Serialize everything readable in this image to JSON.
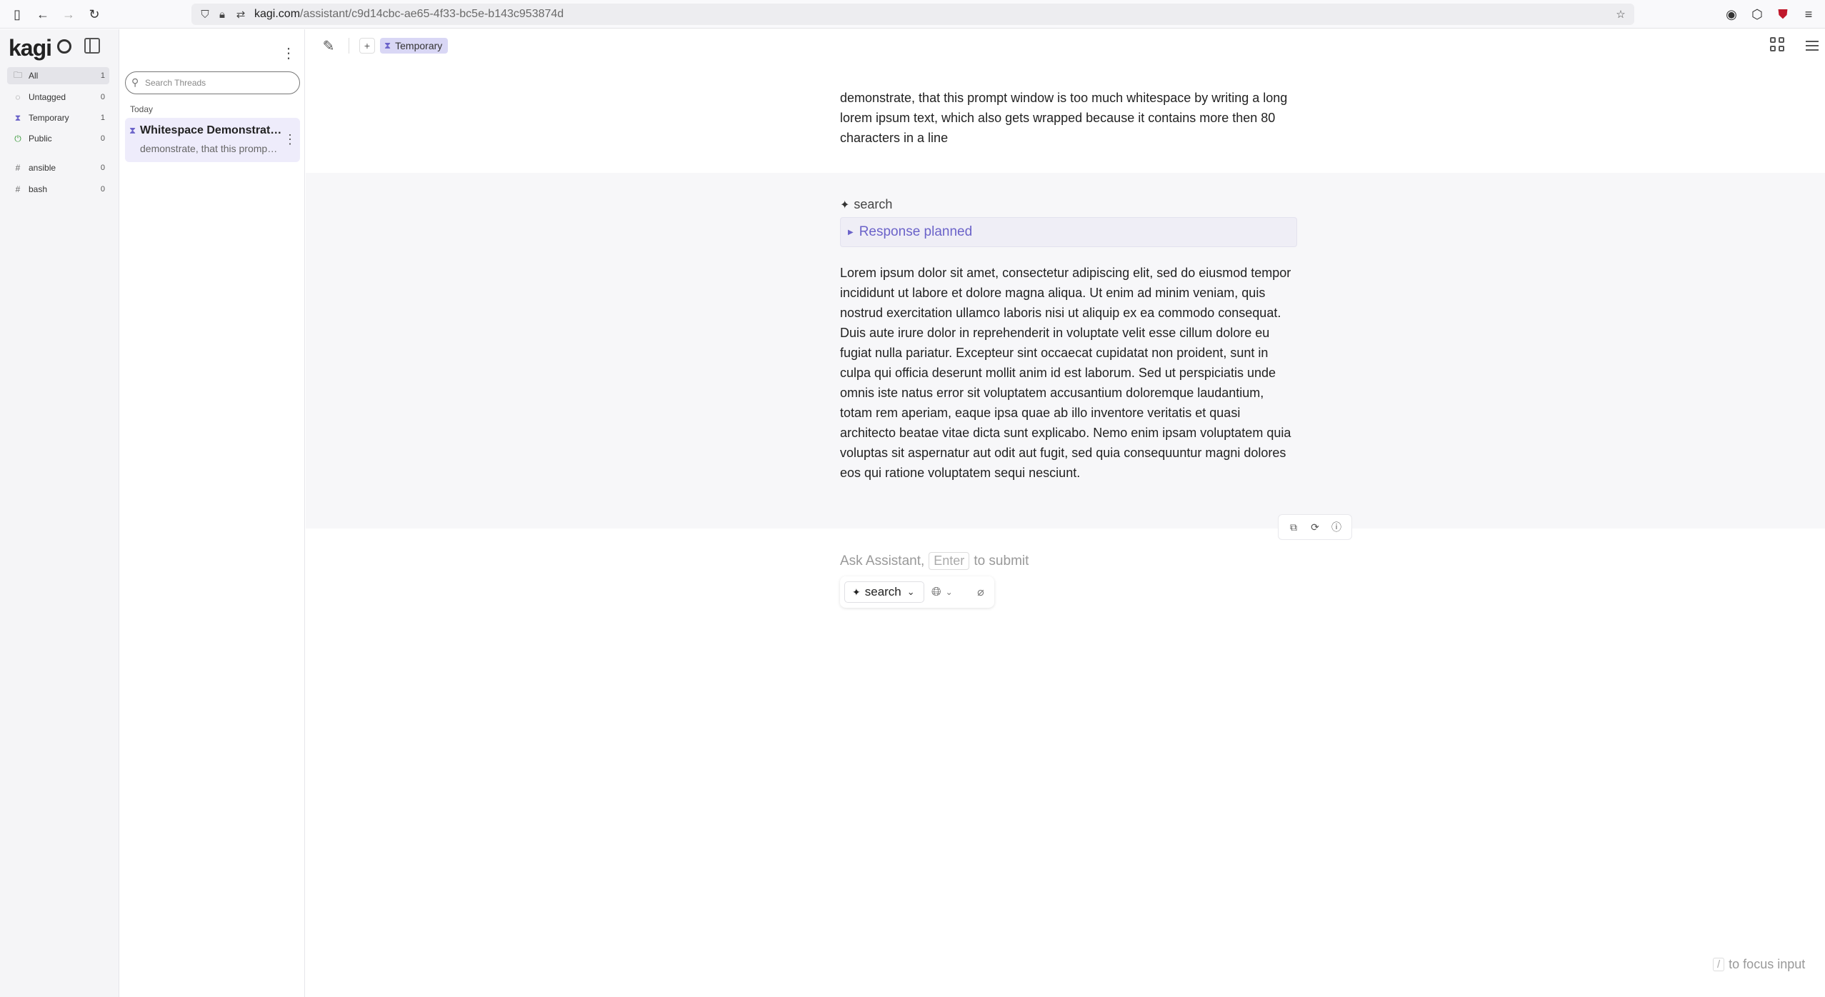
{
  "browser": {
    "url_host": "kagi.com",
    "url_path": "/assistant/c9d14cbc-ae65-4f33-bc5e-b143c953874d"
  },
  "sidebar": {
    "logo": "kagi",
    "items": [
      {
        "label": "All",
        "count": "1",
        "icon": "folder-icon"
      },
      {
        "label": "Untagged",
        "count": "0",
        "icon": "circle-dashed-icon"
      },
      {
        "label": "Temporary",
        "count": "1",
        "icon": "hourglass-icon"
      },
      {
        "label": "Public",
        "count": "0",
        "icon": "power-icon"
      },
      {
        "label": "ansible",
        "count": "0",
        "icon": "hash-icon"
      },
      {
        "label": "bash",
        "count": "0",
        "icon": "hash-icon"
      }
    ]
  },
  "threads": {
    "search_placeholder": "Search Threads",
    "group_label": "Today",
    "items": [
      {
        "title": "Whitespace Demonstration",
        "snippet": "demonstrate, that this prompt window is too much whitespace"
      }
    ]
  },
  "header": {
    "tag_add": "+",
    "tag_label": "Temporary"
  },
  "conversation": {
    "user_message": "demonstrate, that this prompt window is too much whitespace by writing a long lorem ipsum text, which also gets wrapped because it contains more then 80 characters in a line",
    "model_name": "search",
    "planned_label": "Response planned",
    "answer": "Lorem ipsum dolor sit amet, consectetur adipiscing elit, sed do eiusmod tempor incididunt ut labore et dolore magna aliqua. Ut enim ad minim veniam, quis nostrud exercitation ullamco laboris nisi ut aliquip ex ea commodo consequat. Duis aute irure dolor in reprehenderit in voluptate velit esse cillum dolore eu fugiat nulla pariatur. Excepteur sint occaecat cupidatat non proident, sunt in culpa qui officia deserunt mollit anim id est laborum. Sed ut perspiciatis unde omnis iste natus error sit voluptatem accusantium doloremque laudantium, totam rem aperiam, eaque ipsa quae ab illo inventore veritatis et quasi architecto beatae vitae dicta sunt explicabo. Nemo enim ipsam voluptatem quia voluptas sit aspernatur aut odit aut fugit, sed quia consequuntur magni dolores eos qui ratione voluptatem sequi nesciunt."
  },
  "input": {
    "ask_prefix": "Ask Assistant,",
    "ask_key": "Enter",
    "ask_suffix": "to submit",
    "model_select": "search"
  },
  "footer": {
    "focus_key": "/",
    "focus_text": "to focus input"
  },
  "colors": {
    "accent": "#6b63c9",
    "tag_bg": "#d9d7f5",
    "thread_selected_bg": "#eeecfb"
  }
}
